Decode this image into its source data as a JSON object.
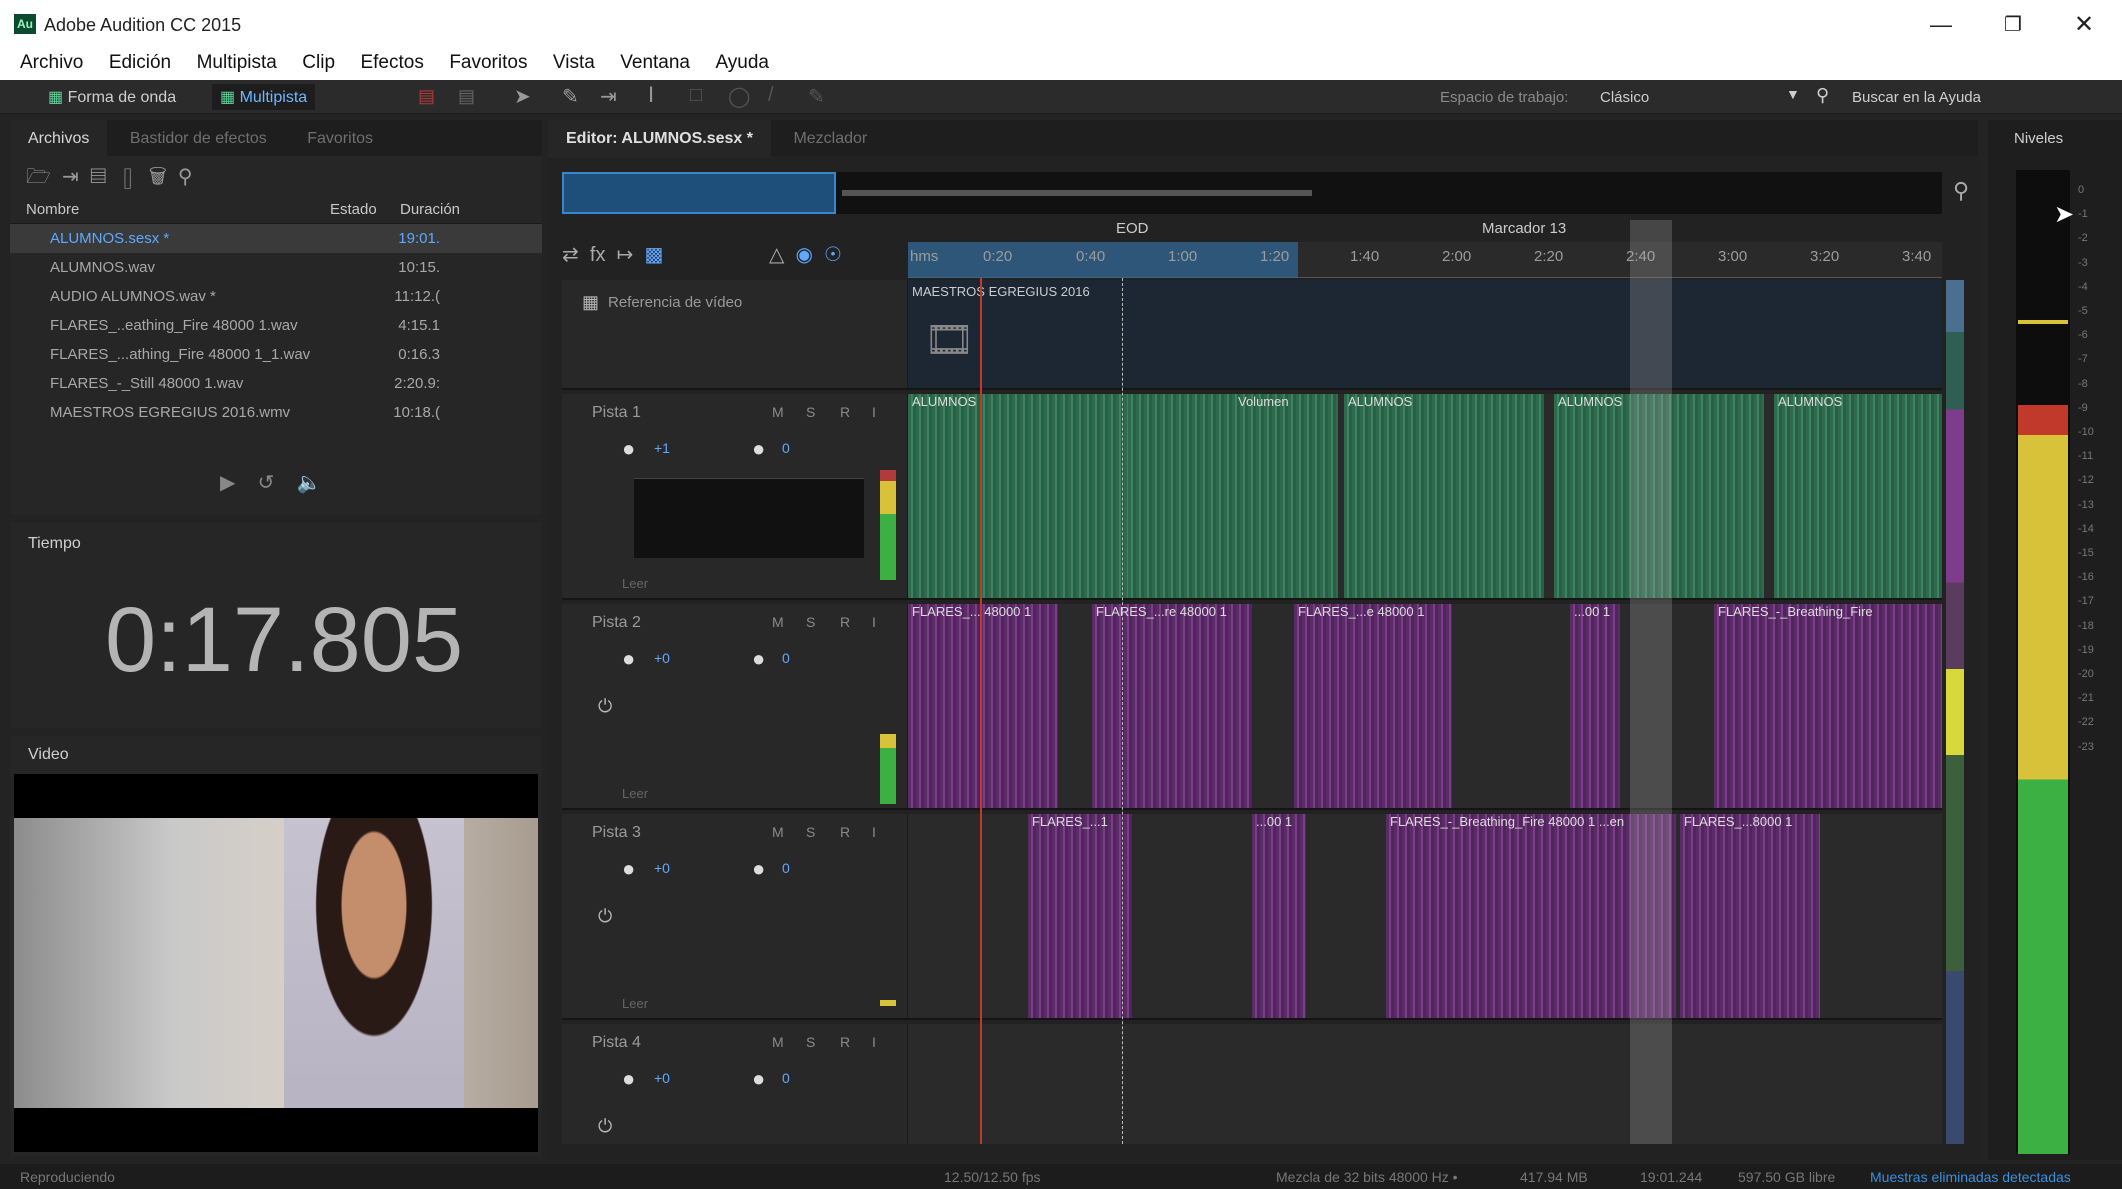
{
  "app": {
    "title": "Adobe Audition CC 2015",
    "icon": "Au"
  },
  "menu": [
    "Archivo",
    "Edición",
    "Multipista",
    "Clip",
    "Efectos",
    "Favoritos",
    "Vista",
    "Ventana",
    "Ayuda"
  ],
  "toolbar": {
    "waveform_label": "Forma de onda",
    "multitrack_label": "Multipista",
    "workspace_label": "Espacio de trabajo:",
    "workspace_value": "Clásico",
    "help_search": "Buscar en la Ayuda"
  },
  "files_panel": {
    "tabs": [
      "Archivos",
      "Bastidor de efectos",
      "Favoritos"
    ],
    "columns": [
      "Nombre",
      "Estado",
      "Duración"
    ],
    "rows": [
      {
        "name": "ALUMNOS.sesx *",
        "duration": "19:01.",
        "selected": true
      },
      {
        "name": "ALUMNOS.wav",
        "duration": "10:15."
      },
      {
        "name": "AUDIO ALUMNOS.wav *",
        "duration": "11:12.("
      },
      {
        "name": "FLARES_..eathing_Fire 48000 1.wav",
        "duration": "4:15.1"
      },
      {
        "name": "FLARES_...athing_Fire 48000 1_1.wav",
        "duration": "0:16.3"
      },
      {
        "name": "FLARES_-_Still 48000 1.wav",
        "duration": "2:20.9:"
      },
      {
        "name": "MAESTROS EGREGIUS 2016.wmv",
        "duration": "10:18.("
      }
    ]
  },
  "time_panel": {
    "title": "Tiempo",
    "value": "0:17.805"
  },
  "video_panel": {
    "title": "Video"
  },
  "editor": {
    "tabs": [
      "Editor: ALUMNOS.sesx *",
      "Mezclador"
    ],
    "ruler": [
      "hms",
      "0:20",
      "0:40",
      "1:00",
      "1:20",
      "1:40",
      "2:00",
      "2:20",
      "2:40",
      "3:00",
      "3:20",
      "3:40"
    ],
    "markers": [
      "EOD",
      "Marcador 13"
    ],
    "video_ref": {
      "label": "Referencia de vídeo",
      "clip": "MAESTROS EGREGIUS 2016"
    },
    "tracks": [
      {
        "name": "Pista 1",
        "vol": "+1",
        "pan": "0",
        "mode": "Leer",
        "clips": [
          "ALUMNOS",
          "ALUMNOS",
          "ALUMNOS",
          "ALUMNOS"
        ],
        "volume_label": "Volumen"
      },
      {
        "name": "Pista 2",
        "vol": "+0",
        "pan": "0",
        "mode": "Leer",
        "clips": [
          "FLARES_... 48000 1",
          "FLARES_...re 48000 1",
          "FLARES_...e 48000 1",
          "...00 1",
          "FLARES_-_Breathing_Fire"
        ]
      },
      {
        "name": "Pista 3",
        "vol": "+0",
        "pan": "0",
        "mode": "Leer",
        "clips": [
          "FLARES_...1",
          "...00 1",
          "FLARES_-_Breathing_Fire 48000 1 ...en",
          "FLARES_...8000 1"
        ]
      },
      {
        "name": "Pista 4",
        "vol": "+0",
        "pan": "0"
      }
    ],
    "msr": [
      "M",
      "S",
      "R",
      "I"
    ]
  },
  "levels": {
    "title": "Niveles",
    "scale": [
      "0",
      "-1",
      "-2",
      "-3",
      "-4",
      "-5",
      "-6",
      "-7",
      "-8",
      "-9",
      "-10",
      "-11",
      "-12",
      "-13",
      "-14",
      "-15",
      "-16",
      "-17",
      "-18",
      "-19",
      "-20",
      "-21",
      "-22",
      "-23"
    ]
  },
  "status": {
    "left": "Reproduciendo",
    "fps": "12.50/12.50 fps",
    "mix": "Mezcla de 32 bits 48000 Hz •",
    "mem": "417.94 MB",
    "dur": "19:01.244",
    "disk": "597.50 GB libre",
    "warn": "Muestras eliminadas detectadas"
  }
}
